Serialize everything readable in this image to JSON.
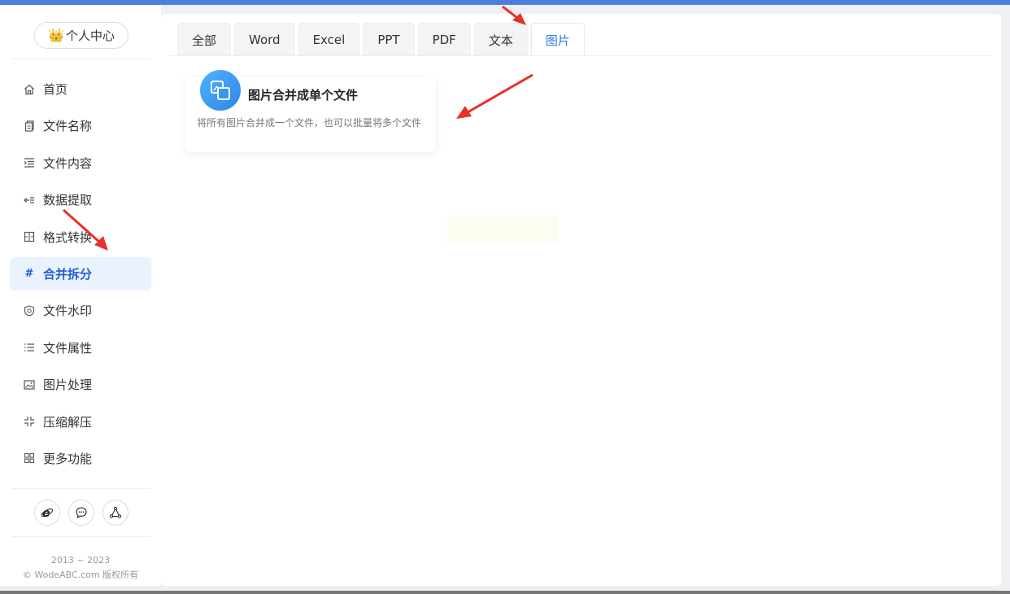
{
  "sidebar": {
    "user_center": "个人中心",
    "nav_items": [
      {
        "label": "首页",
        "icon": "home-icon"
      },
      {
        "label": "文件名称",
        "icon": "file-name-icon"
      },
      {
        "label": "文件内容",
        "icon": "file-content-icon"
      },
      {
        "label": "数据提取",
        "icon": "data-extract-icon"
      },
      {
        "label": "格式转换",
        "icon": "format-convert-icon"
      },
      {
        "label": "合并拆分",
        "icon": "hash-icon"
      },
      {
        "label": "文件水印",
        "icon": "watermark-icon"
      },
      {
        "label": "文件属性",
        "icon": "list-icon"
      },
      {
        "label": "图片处理",
        "icon": "image-icon"
      },
      {
        "label": "压缩解压",
        "icon": "compress-icon"
      },
      {
        "label": "更多功能",
        "icon": "grid-icon"
      }
    ],
    "active_item": "合并拆分",
    "footer_years": "2013 ~ 2023",
    "footer_copyright": "© WodeABC.com 版权所有"
  },
  "tabs": [
    "全部",
    "Word",
    "Excel",
    "PPT",
    "PDF",
    "文本",
    "图片"
  ],
  "active_tab": "图片",
  "card": {
    "title": "图片合并成单个文件",
    "description": "将所有图片合并成一个文件，也可以批量将多个文件"
  },
  "colors": {
    "accent": "#2e7be6",
    "active_nav_bg": "#eaf2ff",
    "arrow": "#e8302a",
    "topbar": "#4a7fdc"
  }
}
